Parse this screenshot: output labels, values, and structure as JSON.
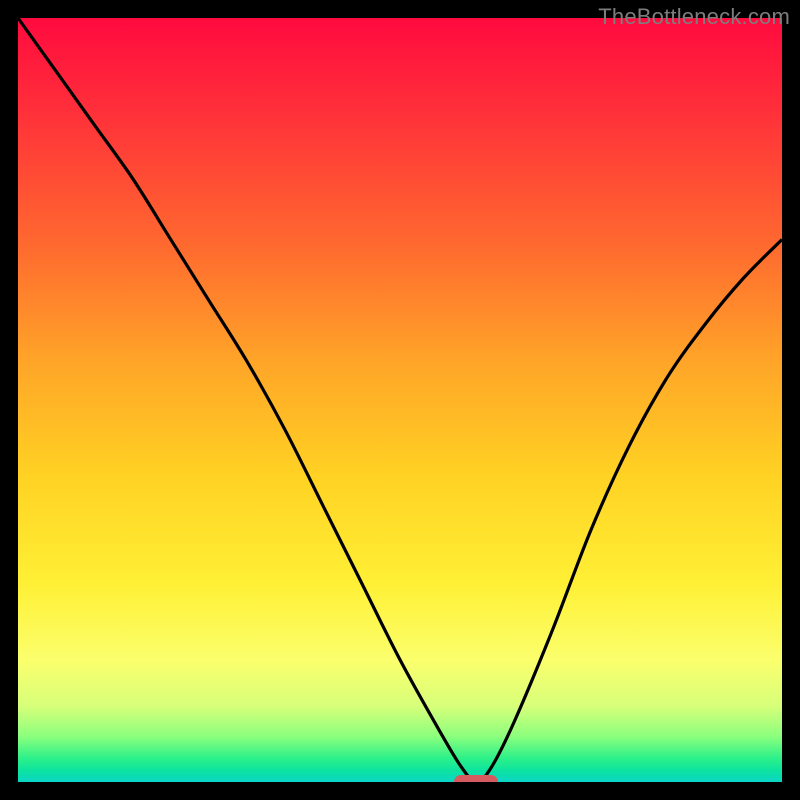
{
  "watermark": "TheBottleneck.com",
  "colors": {
    "curve": "#000000",
    "marker": "#d65a5f",
    "frame_bg": "#000000"
  },
  "chart_data": {
    "type": "line",
    "title": "",
    "xlabel": "",
    "ylabel": "",
    "xlim": [
      0,
      100
    ],
    "ylim": [
      0,
      100
    ],
    "grid": false,
    "legend": false,
    "series": [
      {
        "name": "bottleneck-curve",
        "x": [
          0,
          5,
          10,
          15,
          20,
          25,
          30,
          35,
          40,
          45,
          50,
          55,
          58,
          60,
          62,
          65,
          70,
          75,
          80,
          85,
          90,
          95,
          100
        ],
        "values": [
          100,
          93,
          86,
          79,
          71,
          63,
          55,
          46,
          36,
          26,
          16,
          7,
          2,
          0,
          2,
          8,
          20,
          33,
          44,
          53,
          60,
          66,
          71
        ]
      }
    ],
    "marker": {
      "x": 60,
      "y": 0
    },
    "gradient_stops": [
      {
        "pos": 0,
        "color": "#ff0a3e"
      },
      {
        "pos": 0.3,
        "color": "#ff6a2f"
      },
      {
        "pos": 0.6,
        "color": "#ffd223"
      },
      {
        "pos": 0.84,
        "color": "#fbff6c"
      },
      {
        "pos": 0.97,
        "color": "#29f08a"
      },
      {
        "pos": 1.0,
        "color": "#0bd6c7"
      }
    ]
  }
}
